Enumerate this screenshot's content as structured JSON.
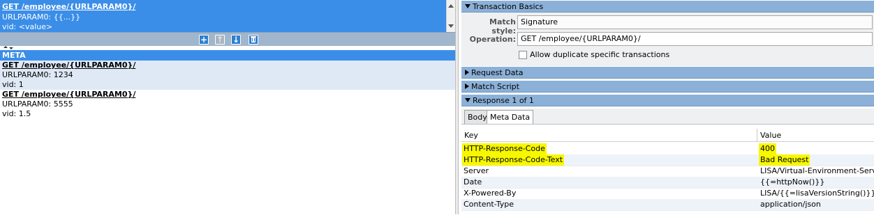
{
  "left": {
    "top_list": {
      "line1": "GET /employee/{URLPARAM0}/",
      "line2": "URLPARAM0: {{...}}",
      "line3": "vid: <value>"
    },
    "toolbar": {
      "add_icon": "plus-icon",
      "up_icon": "arrow-up-icon",
      "down_icon": "arrow-down-icon",
      "delete_icon": "trash-icon"
    },
    "meta_header": "META",
    "entries": [
      {
        "title": "GET /employee/{URLPARAM0}/",
        "param": "URLPARAM0: 1234",
        "vid": "vid: 1"
      },
      {
        "title": "GET /employee/{URLPARAM0}/",
        "param": "URLPARAM0: 5555",
        "vid": "vid: 1.5"
      }
    ]
  },
  "right": {
    "transaction_basics": "Transaction Basics",
    "match_style_label": "Match style:",
    "match_style_value": "Signature",
    "operation_label": "Operation:",
    "operation_value": "GET /employee/{URLPARAM0}/",
    "allow_duplicates": "Allow duplicate specific transactions",
    "request_data": "Request Data",
    "match_script": "Match Script",
    "response_header": "Response 1 of 1",
    "tabs": {
      "body": "Body",
      "meta_data": "Meta Data"
    },
    "table": {
      "col_key": "Key",
      "col_value": "Value",
      "rows": [
        {
          "key": "HTTP-Response-Code",
          "value": "400"
        },
        {
          "key": "HTTP-Response-Code-Text",
          "value": "Bad Request"
        },
        {
          "key": "Server",
          "value": "LISA/Virtual-Environment-Server"
        },
        {
          "key": "Date",
          "value": "{{=httpNow()}}"
        },
        {
          "key": "X-Powered-By",
          "value": "LISA/{{=lisaVersionString()}}"
        },
        {
          "key": "Content-Type",
          "value": "application/json"
        }
      ]
    },
    "colors": {
      "selection": "#3b8ee8",
      "section_bar": "#8cb1d8",
      "highlight": "#f7f700"
    }
  }
}
